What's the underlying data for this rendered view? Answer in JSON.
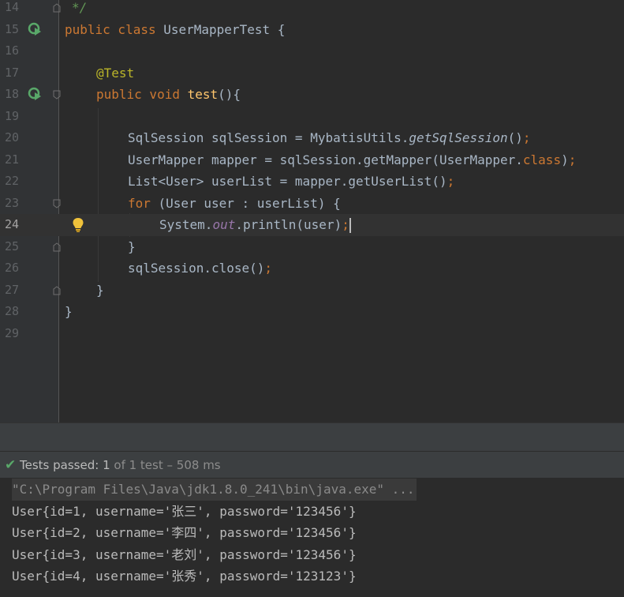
{
  "editor": {
    "lines": [
      {
        "num": "14",
        "text": "*/"
      },
      {
        "num": "15",
        "text": "public class UserMapperTest {"
      },
      {
        "num": "16",
        "text": ""
      },
      {
        "num": "17",
        "text": "@Test"
      },
      {
        "num": "18",
        "text": "public void test(){"
      },
      {
        "num": "19",
        "text": ""
      },
      {
        "num": "20",
        "text": "SqlSession sqlSession = MybatisUtils.getSqlSession();"
      },
      {
        "num": "21",
        "text": "UserMapper mapper = sqlSession.getMapper(UserMapper.class);"
      },
      {
        "num": "22",
        "text": "List<User> userList = mapper.getUserList();"
      },
      {
        "num": "23",
        "text": "for (User user : userList) {"
      },
      {
        "num": "24",
        "text": "System.out.println(user);"
      },
      {
        "num": "25",
        "text": "}"
      },
      {
        "num": "26",
        "text": "sqlSession.close();"
      },
      {
        "num": "27",
        "text": "}"
      },
      {
        "num": "28",
        "text": "}"
      },
      {
        "num": "29",
        "text": ""
      }
    ],
    "current_line": "24",
    "icons": {
      "run_test": "run-test-icon",
      "bulb": "lightbulb-icon",
      "fold": "fold-icon"
    }
  },
  "test_status": {
    "passed_label": "Tests passed:",
    "count": "1",
    "of_total": "of 1 test",
    "separator": "–",
    "duration": "508 ms"
  },
  "console": {
    "command": "\"C:\\Program Files\\Java\\jdk1.8.0_241\\bin\\java.exe\" ...",
    "output": [
      "User{id=1, username='张三', password='123456'}",
      "User{id=2, username='李四', password='123456'}",
      "User{id=3, username='老刘', password='123456'}",
      "User{id=4, username='张秀', password='123123'}"
    ]
  },
  "colors": {
    "background": "#2b2b2b",
    "keyword": "#cc7832",
    "annotation": "#bbb529",
    "method": "#ffc66d",
    "field": "#9876aa",
    "comment": "#629755",
    "pass_green": "#59a869"
  }
}
